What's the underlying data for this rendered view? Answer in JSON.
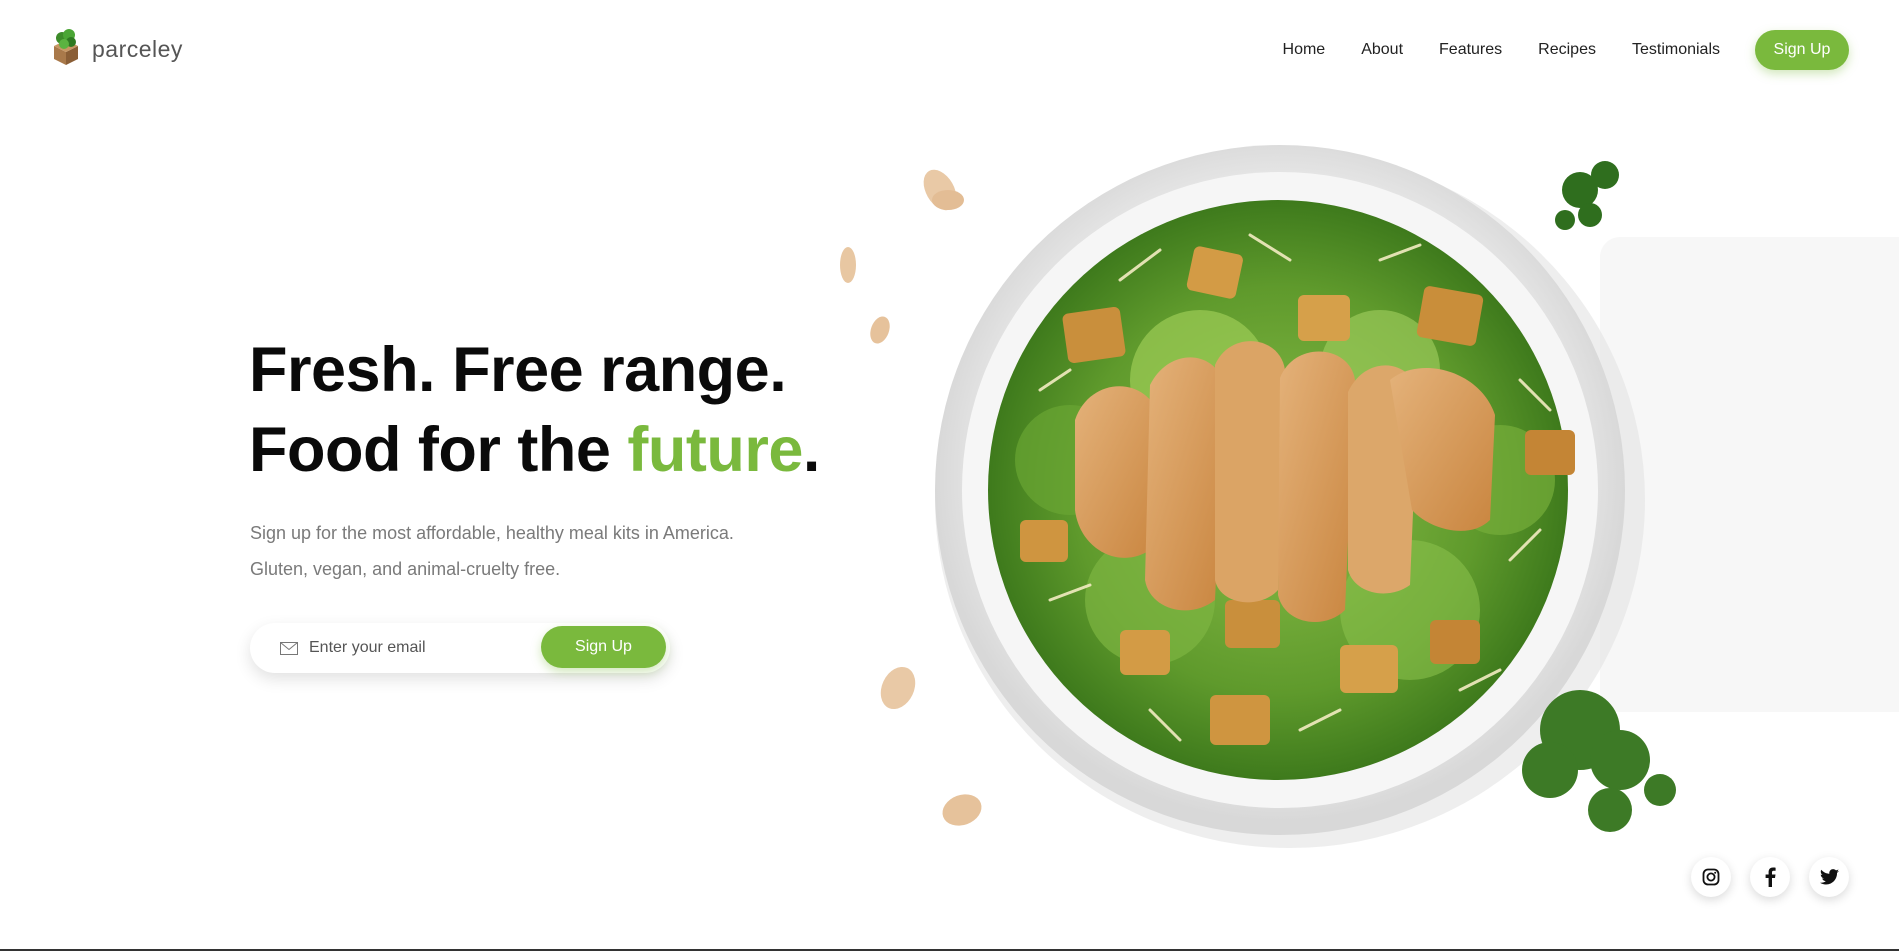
{
  "brand": {
    "name": "parceley"
  },
  "nav": {
    "items": [
      "Home",
      "About",
      "Features",
      "Recipes",
      "Testimonials"
    ],
    "signup_label": "Sign Up"
  },
  "hero": {
    "line1": "Fresh. Free range.",
    "line2_prefix": "Food for the ",
    "line2_accent": "future",
    "line2_suffix": ".",
    "sub1": "Sign up for the most affordable, healthy meal kits in America.",
    "sub2": "Gluten, vegan, and animal-cruelty free."
  },
  "form": {
    "email_placeholder": "Enter your email",
    "signup_label": "Sign Up"
  },
  "social": {
    "icons": [
      "instagram-icon",
      "facebook-icon",
      "twitter-icon"
    ]
  },
  "colors": {
    "accent": "#7ab93d",
    "text": "#0a0a0a",
    "muted": "#7a7a7a"
  }
}
